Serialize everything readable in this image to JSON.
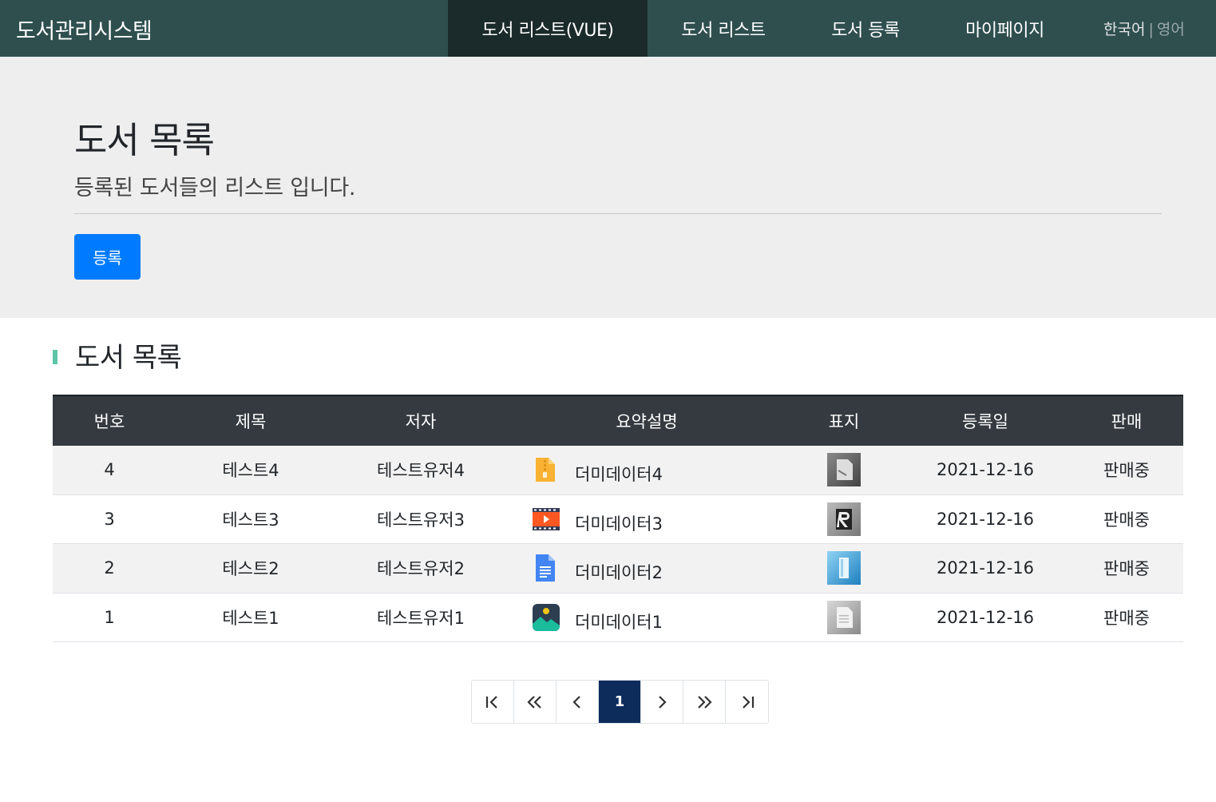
{
  "navbar": {
    "brand": "도서관리시스템",
    "items": [
      {
        "label": "도서 리스트(VUE)",
        "active": true
      },
      {
        "label": "도서 리스트",
        "active": false
      },
      {
        "label": "도서 등록",
        "active": false
      },
      {
        "label": "마이페이지",
        "active": false
      }
    ],
    "lang_ko": "한국어",
    "lang_sep": "|",
    "lang_en": "영어"
  },
  "jumbotron": {
    "title": "도서 목록",
    "subtitle": "등록된 도서들의 리스트 입니다.",
    "register_button": "등록"
  },
  "section": {
    "title": "도서 목록"
  },
  "table": {
    "headers": [
      "번호",
      "제목",
      "저자",
      "요약설명",
      "표지",
      "등록일",
      "판매"
    ],
    "rows": [
      {
        "no": "4",
        "title": "테스트4",
        "author": "테스트유저4",
        "desc": "더미데이터4",
        "file_icon": "zip-file-icon",
        "cover_icon": "cover-gray-page-icon",
        "date": "2021-12-16",
        "sale": "판매중"
      },
      {
        "no": "3",
        "title": "테스트3",
        "author": "테스트유저3",
        "desc": "더미데이터3",
        "file_icon": "video-file-icon",
        "cover_icon": "cover-letter-r-icon",
        "date": "2021-12-16",
        "sale": "판매중"
      },
      {
        "no": "2",
        "title": "테스트2",
        "author": "테스트유저2",
        "desc": "더미데이터2",
        "file_icon": "document-file-icon",
        "cover_icon": "cover-blue-icon",
        "date": "2021-12-16",
        "sale": "판매중"
      },
      {
        "no": "1",
        "title": "테스트1",
        "author": "테스트유저1",
        "desc": "더미데이터1",
        "file_icon": "image-file-icon",
        "cover_icon": "cover-light-page-icon",
        "date": "2021-12-16",
        "sale": "판매중"
      }
    ]
  },
  "pagination": {
    "first": "first-page-icon",
    "prev_block": "double-chevron-left-icon",
    "prev": "chevron-left-icon",
    "current": "1",
    "next": "chevron-right-icon",
    "next_block": "double-chevron-right-icon",
    "last": "last-page-icon"
  },
  "colors": {
    "navbar": "#2f4f4f",
    "navbar_active": "#1b2a2a",
    "jumbotron": "#eeeeee",
    "primary_button": "#007bff",
    "table_header": "#343a40",
    "section_accent": "#5cc6a8",
    "page_active": "#0d2c5c"
  }
}
